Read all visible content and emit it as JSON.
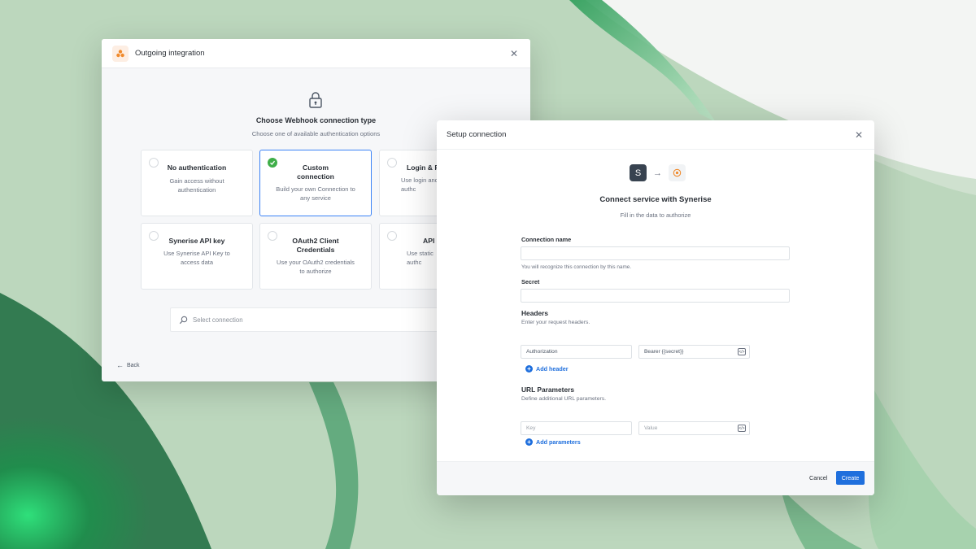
{
  "dialog1": {
    "title": "Outgoing integration",
    "heading": "Choose Webhook connection type",
    "subheading": "Choose one of available authentication options",
    "cards": [
      {
        "title": "No authentication",
        "desc": "Gain access without authentication",
        "selected": false
      },
      {
        "title": "Custom connection",
        "desc": "Build your own Connection to any service",
        "selected": true
      },
      {
        "title": "Login & P",
        "desc": "Use login and authc",
        "selected": false
      },
      {
        "title": "Synerise API key",
        "desc": "Use Synerise API Key to access data",
        "selected": false
      },
      {
        "title": "OAuth2 Client Credentials",
        "desc": "Use your OAuth2 credentials to authorize",
        "selected": false
      },
      {
        "title": "API l",
        "desc": "Use static authc",
        "selected": false
      }
    ],
    "search_placeholder": "Select connection",
    "back_label": "Back"
  },
  "dialog2": {
    "title": "Setup connection",
    "service_letter": "S",
    "heading": "Connect service with Synerise",
    "subheading": "Fill in the data to authorize",
    "connection_name_label": "Connection name",
    "connection_name_value": "",
    "connection_name_helper": "You will recognize this connection by this name.",
    "secret_label": "Secret",
    "secret_value": "",
    "headers_title": "Headers",
    "headers_desc": "Enter your request headers.",
    "header_key": "Authorization",
    "header_value": "Bearer {{secret}}",
    "add_header_label": "Add header",
    "url_params_title": "URL Parameters",
    "url_params_desc": "Define additional URL parameters.",
    "param_key_placeholder": "Key",
    "param_value_placeholder": "Value",
    "add_params_label": "Add parameters",
    "cancel_label": "Cancel",
    "create_label": "Create"
  },
  "colors": {
    "accent": "#1f6fdd",
    "selected_border": "#3b82f6",
    "check_green": "#3fae49",
    "app_icon": "#f08a2c"
  },
  "icons": [
    "app-logo-icon",
    "close-icon",
    "lock-icon",
    "check-icon",
    "search-icon",
    "arrow-left-icon",
    "arrow-right-icon",
    "service-icon",
    "code-icon",
    "plus-icon"
  ]
}
